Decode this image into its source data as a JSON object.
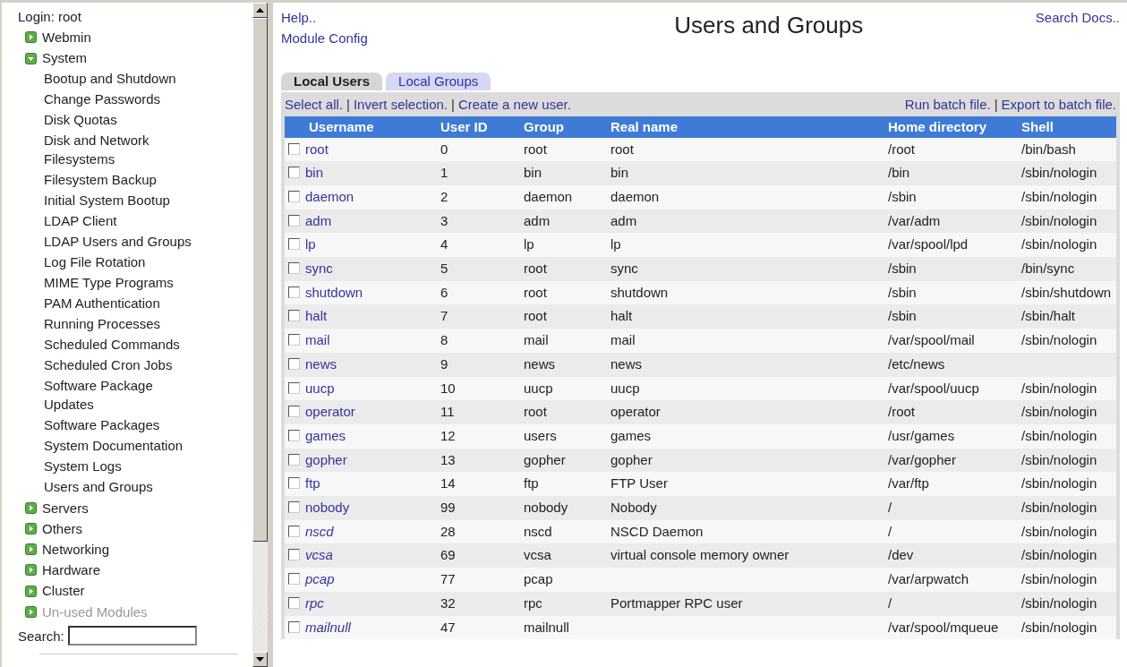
{
  "sidebar": {
    "login": "Login: root",
    "categories": [
      {
        "label": "Webmin",
        "expanded": false,
        "disabled": false
      },
      {
        "label": "System",
        "expanded": true,
        "disabled": false,
        "children": [
          "Bootup and Shutdown",
          "Change Passwords",
          "Disk Quotas",
          "Disk and Network Filesystems",
          "Filesystem Backup",
          "Initial System Bootup",
          "LDAP Client",
          "LDAP Users and Groups",
          "Log File Rotation",
          "MIME Type Programs",
          "PAM Authentication",
          "Running Processes",
          "Scheduled Commands",
          "Scheduled Cron Jobs",
          "Software Package Updates",
          "Software Packages",
          "System Documentation",
          "System Logs",
          "Users and Groups"
        ]
      },
      {
        "label": "Servers",
        "expanded": false,
        "disabled": false
      },
      {
        "label": "Others",
        "expanded": false,
        "disabled": false
      },
      {
        "label": "Networking",
        "expanded": false,
        "disabled": false
      },
      {
        "label": "Hardware",
        "expanded": false,
        "disabled": false
      },
      {
        "label": "Cluster",
        "expanded": false,
        "disabled": false
      },
      {
        "label": "Un-used Modules",
        "expanded": false,
        "disabled": true
      }
    ],
    "search_label": "Search:"
  },
  "header": {
    "links": [
      "Help..",
      "Module Config"
    ],
    "title": "Users and Groups",
    "search_docs": "Search Docs.."
  },
  "tabs": [
    {
      "label": "Local Users",
      "selected": true
    },
    {
      "label": "Local Groups",
      "selected": false
    }
  ],
  "actions_left": [
    {
      "kind": "link",
      "text": "Select all."
    },
    {
      "kind": "separator",
      "text": "|"
    },
    {
      "kind": "link",
      "text": "Invert selection."
    },
    {
      "kind": "separator",
      "text": "|"
    },
    {
      "kind": "link",
      "text": "Create a new user."
    }
  ],
  "actions_right": [
    {
      "kind": "link",
      "text": "Run batch file."
    },
    {
      "kind": "separator",
      "text": "|"
    },
    {
      "kind": "link",
      "text": "Export to batch file."
    }
  ],
  "table": {
    "columns": [
      "Username",
      "User ID",
      "Group",
      "Real name",
      "Home directory",
      "Shell"
    ],
    "rows": [
      {
        "checked": false,
        "disabled": false,
        "cells": [
          "root",
          "0",
          "root",
          "root",
          "/root",
          "/bin/bash"
        ]
      },
      {
        "checked": false,
        "disabled": false,
        "cells": [
          "bin",
          "1",
          "bin",
          "bin",
          "/bin",
          "/sbin/nologin"
        ]
      },
      {
        "checked": false,
        "disabled": false,
        "cells": [
          "daemon",
          "2",
          "daemon",
          "daemon",
          "/sbin",
          "/sbin/nologin"
        ]
      },
      {
        "checked": false,
        "disabled": false,
        "cells": [
          "adm",
          "3",
          "adm",
          "adm",
          "/var/adm",
          "/sbin/nologin"
        ]
      },
      {
        "checked": false,
        "disabled": false,
        "cells": [
          "lp",
          "4",
          "lp",
          "lp",
          "/var/spool/lpd",
          "/sbin/nologin"
        ]
      },
      {
        "checked": false,
        "disabled": false,
        "cells": [
          "sync",
          "5",
          "root",
          "sync",
          "/sbin",
          "/bin/sync"
        ]
      },
      {
        "checked": false,
        "disabled": false,
        "cells": [
          "shutdown",
          "6",
          "root",
          "shutdown",
          "/sbin",
          "/sbin/shutdown"
        ]
      },
      {
        "checked": false,
        "disabled": false,
        "cells": [
          "halt",
          "7",
          "root",
          "halt",
          "/sbin",
          "/sbin/halt"
        ]
      },
      {
        "checked": false,
        "disabled": false,
        "cells": [
          "mail",
          "8",
          "mail",
          "mail",
          "/var/spool/mail",
          "/sbin/nologin"
        ]
      },
      {
        "checked": false,
        "disabled": false,
        "cells": [
          "news",
          "9",
          "news",
          "news",
          "/etc/news",
          ""
        ]
      },
      {
        "checked": false,
        "disabled": false,
        "cells": [
          "uucp",
          "10",
          "uucp",
          "uucp",
          "/var/spool/uucp",
          "/sbin/nologin"
        ]
      },
      {
        "checked": false,
        "disabled": false,
        "cells": [
          "operator",
          "11",
          "root",
          "operator",
          "/root",
          "/sbin/nologin"
        ]
      },
      {
        "checked": false,
        "disabled": false,
        "cells": [
          "games",
          "12",
          "users",
          "games",
          "/usr/games",
          "/sbin/nologin"
        ]
      },
      {
        "checked": false,
        "disabled": false,
        "cells": [
          "gopher",
          "13",
          "gopher",
          "gopher",
          "/var/gopher",
          "/sbin/nologin"
        ]
      },
      {
        "checked": false,
        "disabled": false,
        "cells": [
          "ftp",
          "14",
          "ftp",
          "FTP User",
          "/var/ftp",
          "/sbin/nologin"
        ]
      },
      {
        "checked": false,
        "disabled": false,
        "cells": [
          "nobody",
          "99",
          "nobody",
          "Nobody",
          "/",
          "/sbin/nologin"
        ]
      },
      {
        "checked": false,
        "disabled": true,
        "cells": [
          "nscd",
          "28",
          "nscd",
          "NSCD Daemon",
          "/",
          "/sbin/nologin"
        ]
      },
      {
        "checked": false,
        "disabled": true,
        "cells": [
          "vcsa",
          "69",
          "vcsa",
          "virtual console memory owner",
          "/dev",
          "/sbin/nologin"
        ]
      },
      {
        "checked": false,
        "disabled": true,
        "cells": [
          "pcap",
          "77",
          "pcap",
          "",
          "/var/arpwatch",
          "/sbin/nologin"
        ]
      },
      {
        "checked": false,
        "disabled": true,
        "cells": [
          "rpc",
          "32",
          "rpc",
          "Portmapper RPC user",
          "/",
          "/sbin/nologin"
        ]
      },
      {
        "checked": false,
        "disabled": true,
        "cells": [
          "mailnull",
          "47",
          "mailnull",
          "",
          "/var/spool/mqueue",
          "/sbin/nologin"
        ]
      }
    ]
  }
}
